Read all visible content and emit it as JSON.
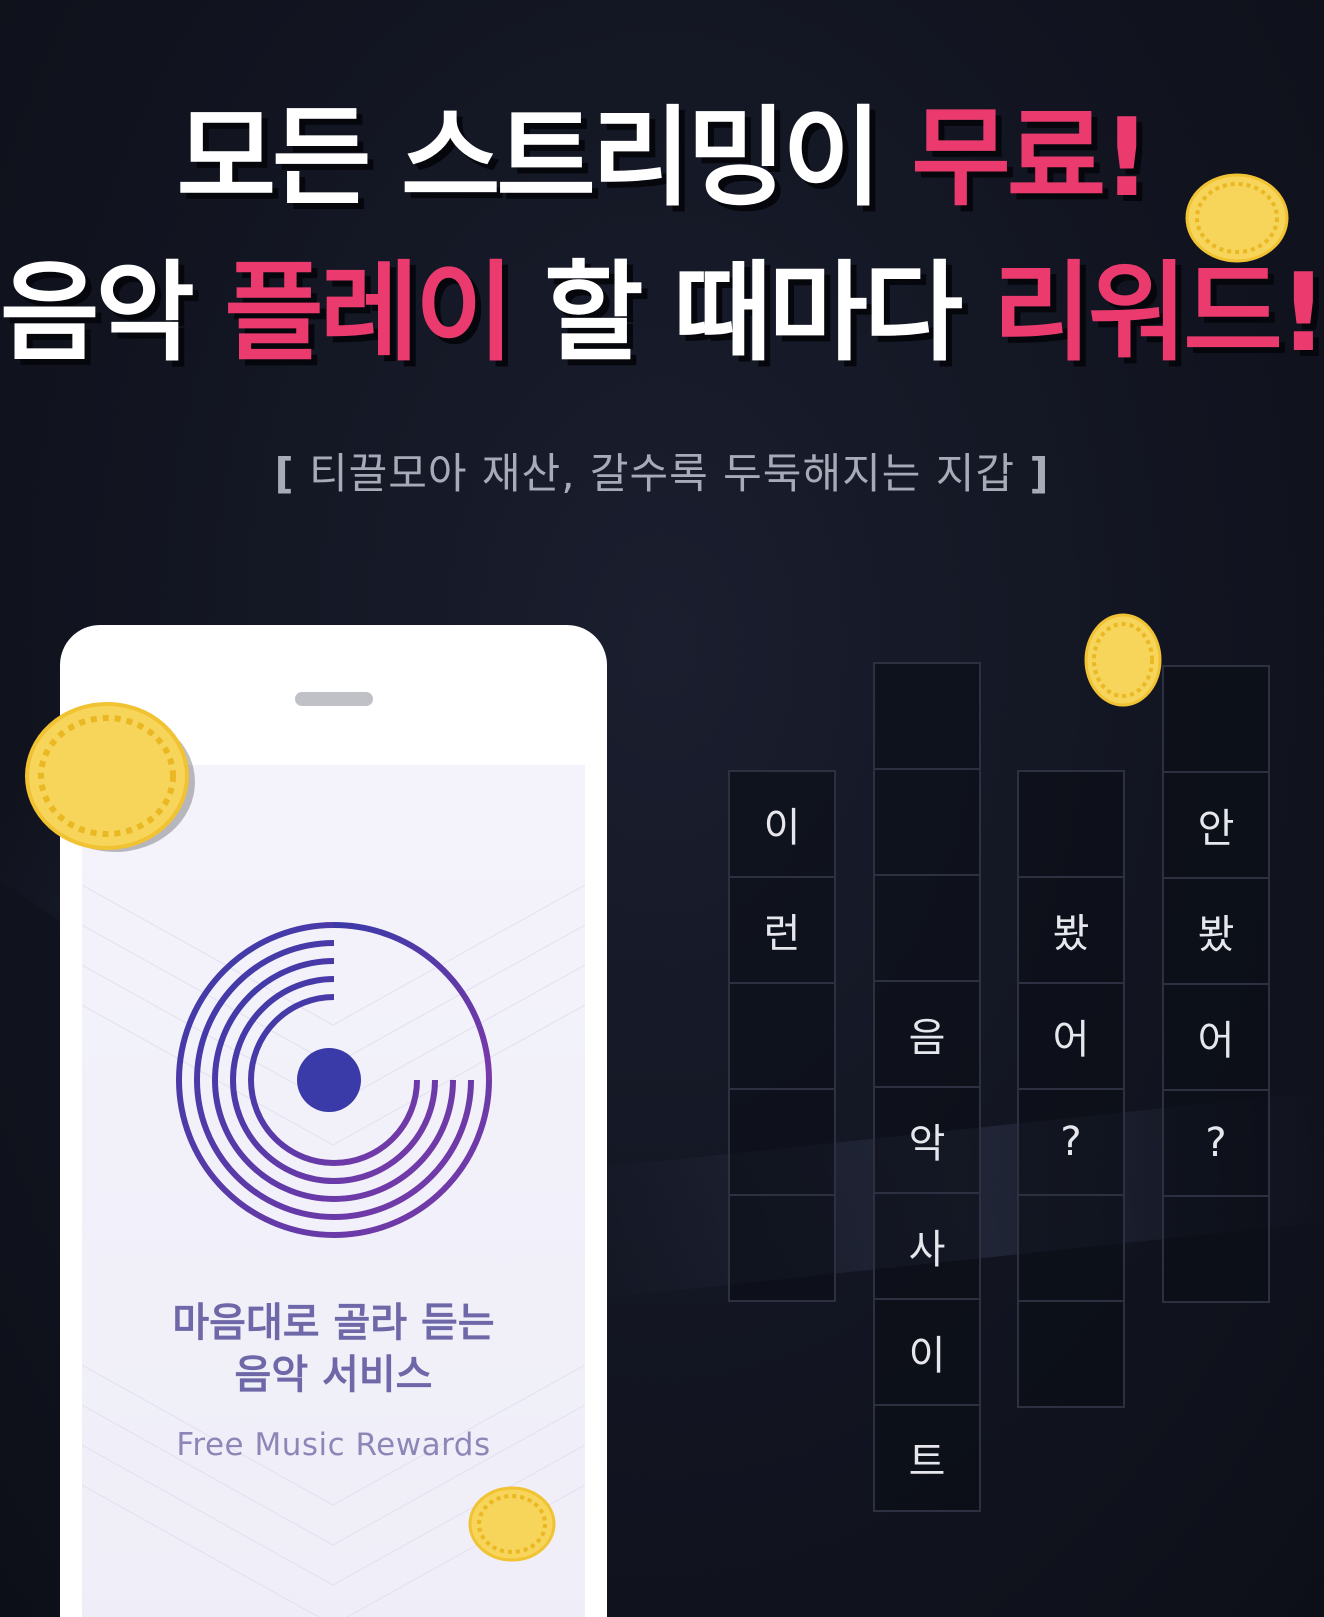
{
  "headline": {
    "line1_prefix": "모든 스트리밍이 ",
    "line1_accent": "무료!",
    "line2_word1": "음악 ",
    "line2_accent1": "플레이",
    "line2_mid": " 할 때마다 ",
    "line2_accent2": "리워드!"
  },
  "tagline": {
    "open": "[",
    "text": "티끌모아 재산, 갈수록 두둑해지는 지갑",
    "close": "]"
  },
  "phone": {
    "app_name_line1": "마음대로 골라 듣는",
    "app_name_line2": "음악 서비스",
    "app_subtitle": "Free Music Rewards"
  },
  "grid": {
    "col1": [
      "이",
      "런",
      "",
      "",
      ""
    ],
    "col2": [
      "",
      "",
      "",
      "음",
      "악",
      "사",
      "이",
      "트"
    ],
    "col3": [
      "",
      "봤",
      "어",
      "?",
      "",
      ""
    ],
    "col4": [
      "",
      "안",
      "봤",
      "어",
      "?",
      ""
    ]
  },
  "colors": {
    "accent": "#ea3a6e",
    "background": "#121521",
    "logo_start": "#3a3aa8",
    "logo_end": "#7a3aa8",
    "coin": "#f7d45a"
  },
  "icons": [
    "music-disc-logo-icon",
    "coin-icon"
  ]
}
